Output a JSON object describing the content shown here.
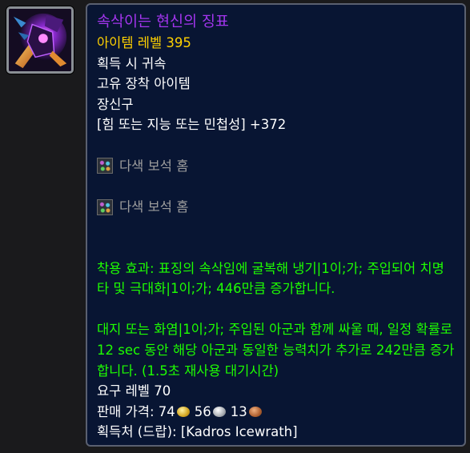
{
  "item": {
    "icon": "item-icon-artwork",
    "name": "속삭이는 현신의 징표",
    "item_level": "아이템 레벨 395",
    "binding": "획득 시 귀속",
    "unique": "고유 장착 아이템",
    "slot": "장신구",
    "stat": "[힘 또는 지능 또는 민첩성] +372",
    "sockets": [
      {
        "icon": "prismatic-socket-icon",
        "label": "다색 보석 홈"
      },
      {
        "icon": "prismatic-socket-icon",
        "label": "다색 보석 홈"
      }
    ],
    "equip_effect": "착용 효과: 표징의 속삭임에 굴복해 냉기|1이;가; 주입되어 치명타 및 극대화|1이;가; 446만큼 증가합니다.",
    "proc_effect": "대지 또는 화염|1이;가; 주입된 아군과 함께 싸울 때, 일정 확률로 12 sec 동안 해당 아군과 동일한 능력치가 추가로 242만큼 증가합니다. (1.5초 재사용 대기시간)",
    "required_level": "요구 레벨 70",
    "sell_price": {
      "label": "판매 가격: ",
      "gold": "74",
      "silver": "56",
      "copper": "13"
    },
    "source": "획득처 (드랍): [Kadros Icewrath]"
  },
  "colors": {
    "background": "#081533",
    "epic": "#a335ee",
    "item_level": "#ffd100",
    "effect": "#1eff00",
    "socket_text": "#9d9d9d"
  }
}
